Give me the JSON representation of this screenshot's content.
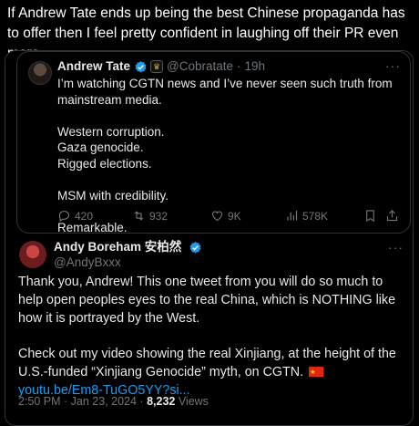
{
  "caption": "If Andrew Tate ends up being the best Chinese propaganda has to offer then I feel pretty confident in laughing off their PR even more.",
  "quoted_tweet": {
    "name": "Andrew Tate",
    "handle": "@Cobratate",
    "separator": "·",
    "time": "19h",
    "text": "I’m watching CGTN news and I’ve never seen such truth from mainstream media.\n\nWestern corruption.\nGaza genocide.\nRigged elections.\n\nMSM with credibility.\n\nRemarkable.",
    "replies": "420",
    "retweets": "932",
    "likes": "9K",
    "views": "578K"
  },
  "main_tweet": {
    "name": "Andy Boreham 安柏然",
    "handle": "@AndyBxxx",
    "text": "Thank you, Andrew! This one tweet from you will do so much to help open peoples eyes to the real China, which is NOTHING like how it is portrayed by the West.\n\nCheck out my video showing the real Xinjiang, at the height of the U.S.-funded “Xinjiang Genocide” myth, on CGTN.",
    "link": "youtu.be/Em8-TuGO5YY?si...",
    "time": "2:50 PM · Jan 23, 2024 · ",
    "views_count": "8,232",
    "views_label": " Views"
  },
  "more_label": "···",
  "colors": {
    "background": "#000000",
    "text": "#e7e9ea",
    "muted": "#71767b",
    "link": "#1d9bf0",
    "verified": "#1d9bf0",
    "border": "#2f3336"
  }
}
